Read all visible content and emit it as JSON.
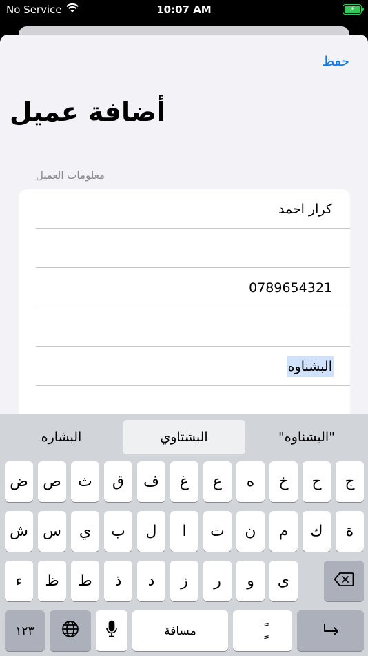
{
  "status_bar": {
    "carrier": "No Service",
    "time": "10:07 AM"
  },
  "nav": {
    "save_label": "حفظ"
  },
  "page": {
    "title": "أضافة عميل",
    "section_header": "معلومات العميل"
  },
  "form": {
    "fields": [
      {
        "value": "كرار احمد"
      },
      {
        "value": ""
      },
      {
        "value": "0789654321"
      },
      {
        "value": ""
      },
      {
        "value": "البشناوه"
      },
      {
        "value": ""
      }
    ]
  },
  "keyboard": {
    "suggestions": [
      "\"البشناوه\"",
      "البشتاوي",
      "البشاره"
    ],
    "row1": [
      "ض",
      "ص",
      "ث",
      "ق",
      "ف",
      "غ",
      "ع",
      "ه",
      "خ",
      "ح",
      "ج"
    ],
    "row2": [
      "ش",
      "س",
      "ي",
      "ب",
      "ل",
      "ا",
      "ت",
      "ن",
      "م",
      "ك",
      "ة"
    ],
    "row3": [
      "ء",
      "ظ",
      "ط",
      "ذ",
      "د",
      "ز",
      "ر",
      "و",
      "ى"
    ],
    "numbers_label": "١٢٣",
    "space_label": "مسافة",
    "tashkeel_label": "ًٍ"
  }
}
